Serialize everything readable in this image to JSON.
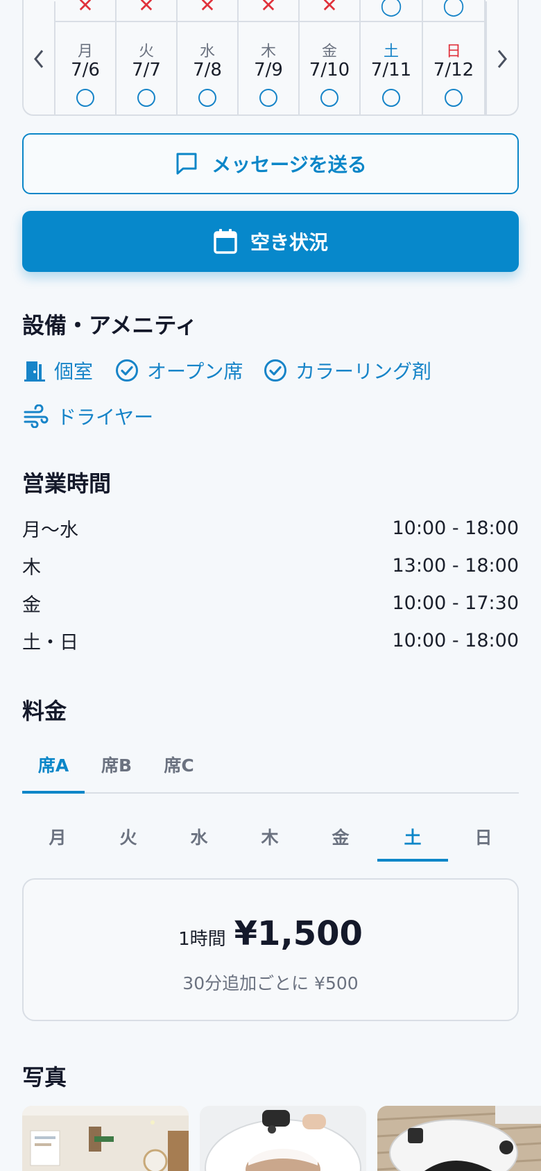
{
  "calendar": {
    "prev_icon": "chevron-left-icon",
    "next_icon": "chevron-right-icon",
    "prev_row": [
      "✕",
      "✕",
      "✕",
      "✕",
      "✕",
      "◯",
      "◯"
    ],
    "days": [
      {
        "dow": "月",
        "date": "7/6",
        "status": "◯"
      },
      {
        "dow": "火",
        "date": "7/7",
        "status": "◯"
      },
      {
        "dow": "水",
        "date": "7/8",
        "status": "◯"
      },
      {
        "dow": "木",
        "date": "7/9",
        "status": "◯"
      },
      {
        "dow": "金",
        "date": "7/10",
        "status": "◯"
      },
      {
        "dow": "土",
        "date": "7/11",
        "status": "◯"
      },
      {
        "dow": "日",
        "date": "7/12",
        "status": "◯"
      }
    ]
  },
  "actions": {
    "message_label": "メッセージを送る",
    "message_icon": "chat-bubble-icon",
    "availability_label": "空き状況",
    "availability_icon": "calendar-icon"
  },
  "amenities": {
    "title": "設備・アメニティ",
    "items": [
      {
        "label": "個室",
        "icon": "door-icon"
      },
      {
        "label": "オープン席",
        "icon": "check-circle-icon"
      },
      {
        "label": "カラーリング剤",
        "icon": "check-circle-icon"
      },
      {
        "label": "ドライヤー",
        "icon": "wind-icon"
      }
    ]
  },
  "hours": {
    "title": "営業時間",
    "rows": [
      {
        "day": "月〜水",
        "time": "10:00 - 18:00"
      },
      {
        "day": "木",
        "time": "13:00 - 18:00"
      },
      {
        "day": "金",
        "time": "10:00 - 17:30"
      },
      {
        "day": "土・日",
        "time": "10:00 - 18:00"
      }
    ]
  },
  "pricing": {
    "title": "料金",
    "seat_tabs": [
      "席A",
      "席B",
      "席C"
    ],
    "active_seat": "席A",
    "day_tabs": [
      "月",
      "火",
      "水",
      "木",
      "金",
      "土",
      "日"
    ],
    "active_day": "土",
    "unit": "1時間",
    "price": "¥1,500",
    "extra": "30分追加ごとに ¥500"
  },
  "photos": {
    "title": "写真"
  },
  "colors": {
    "accent": "#0788cb",
    "unavailable": "#e0313b",
    "saturday": "#1784c8",
    "sunday": "#e0313b"
  }
}
